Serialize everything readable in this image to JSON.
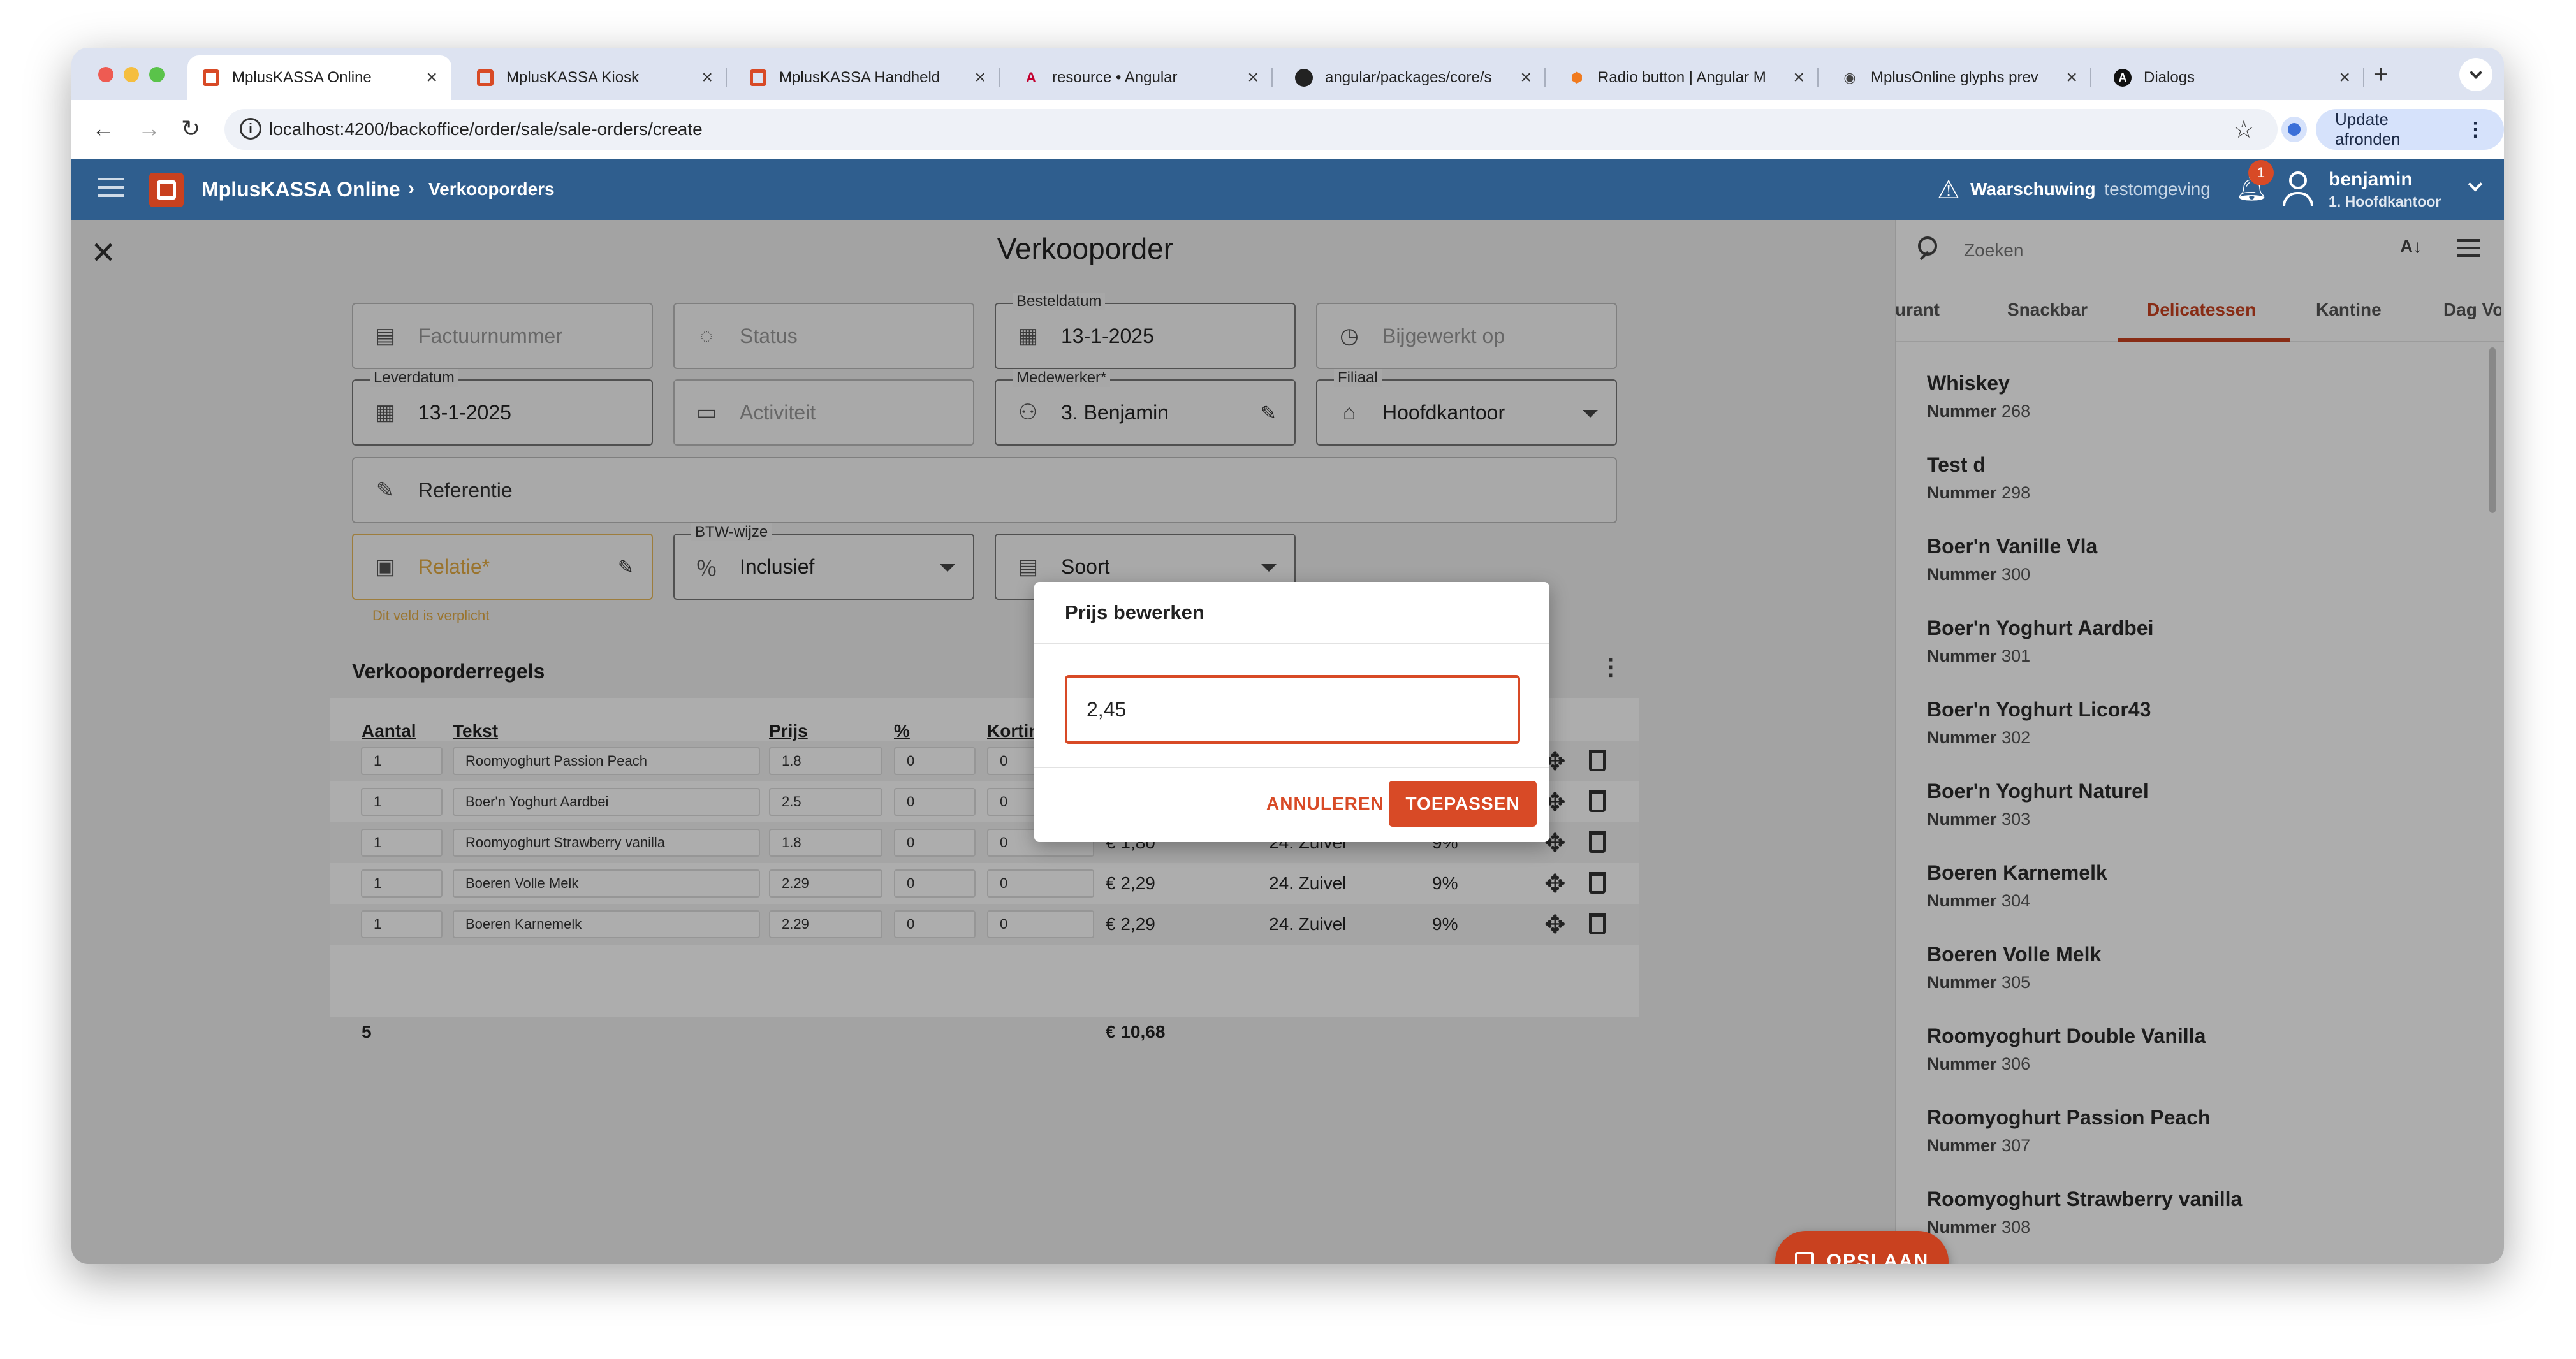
{
  "browser": {
    "tabs": [
      {
        "title": "MplusKASSA Online"
      },
      {
        "title": "MplusKASSA Kiosk"
      },
      {
        "title": "MplusKASSA Handheld"
      },
      {
        "title": "resource • Angular"
      },
      {
        "title": "angular/packages/core/s"
      },
      {
        "title": "Radio button | Angular M"
      },
      {
        "title": "MplusOnline glyphs prev"
      },
      {
        "title": "Dialogs"
      }
    ],
    "url": "localhost:4200/backoffice/order/sale/sale-orders/create",
    "update_label": "Update afronden"
  },
  "appbar": {
    "title": "MplusKASSA Online",
    "breadcrumb": "Verkooporders",
    "warning_bold": "Waarschuwing",
    "warning_rest": "testomgeving",
    "notification_count": "1",
    "user_name": "benjamin",
    "user_branch": "1. Hoofdkantoor"
  },
  "page": {
    "title": "Verkooporder"
  },
  "form": {
    "factuurnummer": "Factuurnummer",
    "status": "Status",
    "besteldatum_label": "Besteldatum",
    "besteldatum": "13-1-2025",
    "bijgewerkt": "Bijgewerkt op",
    "leverdatum_label": "Leverdatum",
    "leverdatum": "13-1-2025",
    "activiteit": "Activiteit",
    "medewerker_label": "Medewerker*",
    "medewerker": "3. Benjamin",
    "filiaal_label": "Filiaal",
    "filiaal": "Hoofdkantoor",
    "referentie": "Referentie",
    "relatie": "Relatie*",
    "relatie_error": "Dit veld is verplicht",
    "btw_label": "BTW-wijze",
    "btw": "Inclusief",
    "soort": "Soort"
  },
  "lines": {
    "title": "Verkooporderregels",
    "headers": [
      "Aantal",
      "Tekst",
      "Prijs",
      "%",
      "Korting"
    ],
    "rows": [
      {
        "qty": "1",
        "text": "Roomyoghurt Passion Peach",
        "price": "1.8",
        "pct": "0",
        "disc": "0",
        "total": "",
        "group": "",
        "vat": ""
      },
      {
        "qty": "1",
        "text": "Boer'n Yoghurt Aardbei",
        "price": "2.5",
        "pct": "0",
        "disc": "0",
        "total": "",
        "group": "",
        "vat": ""
      },
      {
        "qty": "1",
        "text": "Roomyoghurt Strawberry vanilla",
        "price": "1.8",
        "pct": "0",
        "disc": "0",
        "total": "€ 1,80",
        "group": "24. Zuivel",
        "vat": "9%"
      },
      {
        "qty": "1",
        "text": "Boeren Volle Melk",
        "price": "2.29",
        "pct": "0",
        "disc": "0",
        "total": "€ 2,29",
        "group": "24. Zuivel",
        "vat": "9%"
      },
      {
        "qty": "1",
        "text": "Boeren Karnemelk",
        "price": "2.29",
        "pct": "0",
        "disc": "0",
        "total": "€ 2,29",
        "group": "24. Zuivel",
        "vat": "9%"
      }
    ],
    "total_qty": "5",
    "total_amount": "€ 10,68"
  },
  "dialog": {
    "title": "Prijs bewerken",
    "value": "2,45",
    "cancel": "ANNULEREN",
    "apply": "TOEPASSEN"
  },
  "save_label": "OPSLAAN",
  "side": {
    "search_placeholder": "Zoeken",
    "tabs": [
      "urant",
      "Snackbar",
      "Delicatessen",
      "Kantine",
      "Dag Vo"
    ],
    "number_label": "Nummer",
    "items": [
      {
        "name": "Whiskey",
        "nr": "268"
      },
      {
        "name": "Test d",
        "nr": "298"
      },
      {
        "name": "Boer'n Vanille Vla",
        "nr": "300"
      },
      {
        "name": "Boer'n Yoghurt Aardbei",
        "nr": "301"
      },
      {
        "name": "Boer'n Yoghurt Licor43",
        "nr": "302"
      },
      {
        "name": "Boer'n Yoghurt Naturel",
        "nr": "303"
      },
      {
        "name": "Boeren Karnemelk",
        "nr": "304"
      },
      {
        "name": "Boeren Volle Melk",
        "nr": "305"
      },
      {
        "name": "Roomyoghurt Double Vanilla",
        "nr": "306"
      },
      {
        "name": "Roomyoghurt Passion Peach",
        "nr": "307"
      },
      {
        "name": "Roomyoghurt Strawberry vanilla",
        "nr": "308"
      }
    ]
  },
  "colors": {
    "brand": "#2f5e8e",
    "accent": "#d84a26"
  }
}
